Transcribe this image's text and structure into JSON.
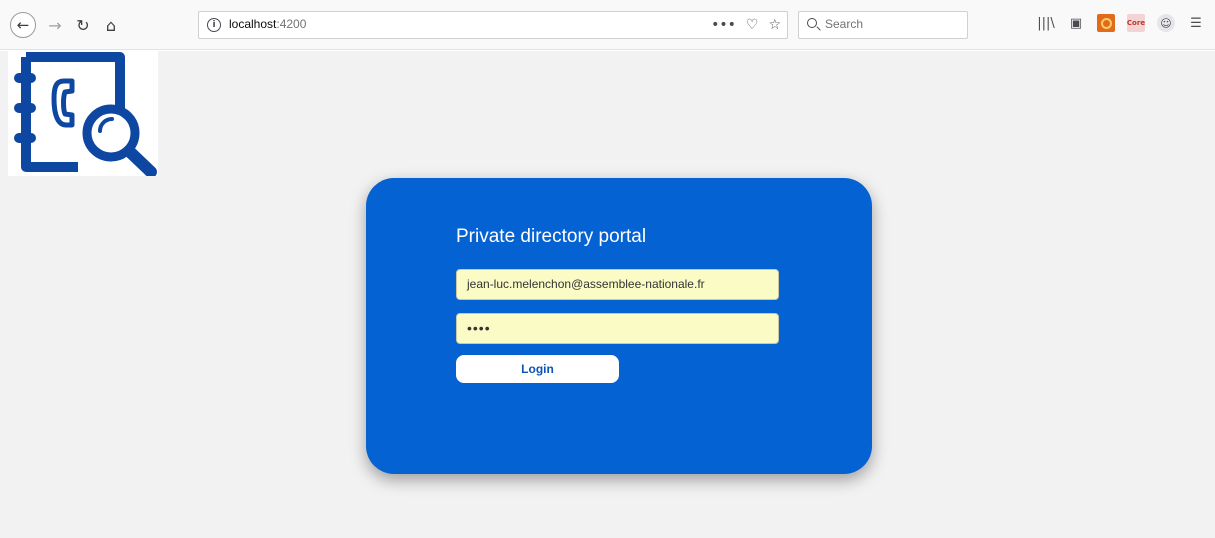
{
  "browser": {
    "url_host": "localhost",
    "url_port": ":4200",
    "search_placeholder": "Search",
    "page_actions_label": "•••",
    "library_label": "|||\\",
    "extension_label": "Core"
  },
  "login": {
    "title": "Private directory portal",
    "email_value": "jean-luc.melenchon@assemblee-nationale.fr",
    "password_masked": "••••",
    "login_label": "Login"
  },
  "colors": {
    "card": "#0562d3",
    "input_bg": "#fbfbc6",
    "logo_blue": "#0d47a1"
  }
}
